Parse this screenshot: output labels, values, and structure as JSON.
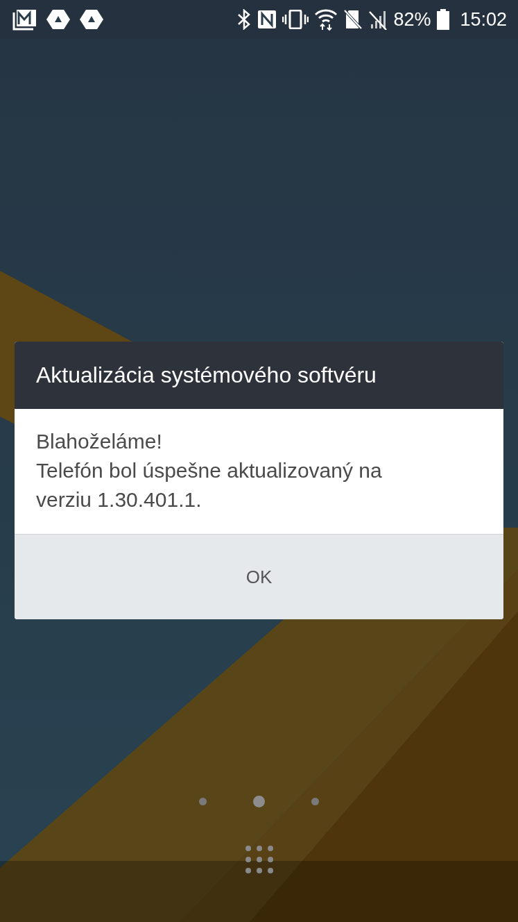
{
  "status_bar": {
    "battery": "82%",
    "time": "15:02"
  },
  "dialog": {
    "title": "Aktualizácia systémového softvéru",
    "message": [
      "Blahoželáme!",
      "Telefón bol úspešne aktualizovaný na verziu 1.30.401.1."
    ],
    "button": "OK"
  },
  "home_pages": [
    {
      "selected": false
    },
    {
      "selected": true
    },
    {
      "selected": false
    }
  ]
}
